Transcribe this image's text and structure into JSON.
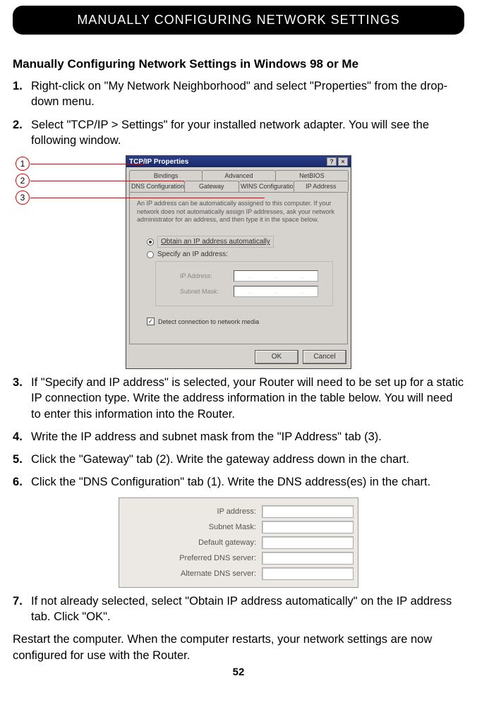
{
  "header": {
    "title": "MANUALLY CONFIGURING NETWORK SETTINGS"
  },
  "subtitle": "Manually Configuring Network Settings in Windows 98 or Me",
  "steps": {
    "s1": "Right-click on \"My Network Neighborhood\" and select \"Properties\" from the drop-down menu.",
    "s2": "Select \"TCP/IP > Settings\" for your installed network adapter. You will see the following window.",
    "s3": "If \"Specify and IP address\" is selected, your Router will need to be set up for a static IP connection type. Write the address information in the table below. You will need to enter this information into the Router.",
    "s4": "Write the IP address and subnet mask from the \"IP Address\" tab (3).",
    "s5": "Click the \"Gateway\" tab (2). Write the gateway address down in the chart.",
    "s6": "Click the \"DNS Configuration\" tab (1). Write the DNS address(es) in the chart.",
    "s7": "If not already selected, select \"Obtain IP address automatically\" on the IP address tab. Click \"OK\"."
  },
  "callouts": {
    "c1": "1",
    "c2": "2",
    "c3": "3"
  },
  "dialog": {
    "title": "TCP/IP Properties",
    "help_btn": "?",
    "close_btn": "×",
    "tabs_row1": {
      "t1": "Bindings",
      "t2": "Advanced",
      "t3": "NetBIOS"
    },
    "tabs_row2": {
      "t1": "DNS Configuration",
      "t2": "Gateway",
      "t3": "WINS Configuration",
      "t4": "IP Address"
    },
    "desc": "An IP address can be automatically assigned to this computer. If your network does not automatically assign IP addresses, ask your network administrator for an address, and then type it in the space below.",
    "radio1": "Obtain an IP address automatically",
    "radio2": "Specify an IP address:",
    "ip_label": "IP Address:",
    "subnet_label": "Subnet Mask:",
    "check_label": "Detect connection to network media",
    "ok": "OK",
    "cancel": "Cancel"
  },
  "info_table": {
    "r1": "IP address:",
    "r2": "Subnet Mask:",
    "r3": "Default gateway:",
    "r4": "Preferred DNS server:",
    "r5": "Alternate DNS server:"
  },
  "closing": "Restart the computer. When the computer restarts, your network settings are now configured for use with the Router.",
  "page_num": "52"
}
